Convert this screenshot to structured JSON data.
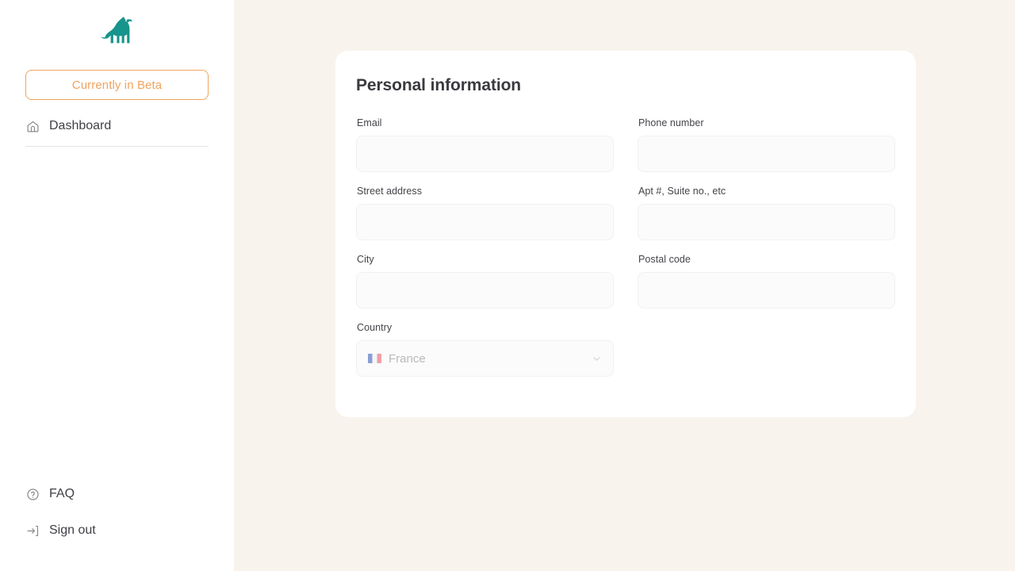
{
  "sidebar": {
    "logo": {
      "icon": "dog-logo-icon",
      "color": "#17948c"
    },
    "beta_badge": {
      "label": "Currently in Beta",
      "color": "#f0a45e"
    },
    "nav_items": [
      {
        "label": "Dashboard",
        "icon": "home-icon"
      }
    ],
    "bottom_items": [
      {
        "label": "FAQ",
        "icon": "question-circle-icon"
      },
      {
        "label": "Sign out",
        "icon": "sign-out-icon"
      }
    ]
  },
  "main": {
    "card": {
      "title": "Personal information",
      "fields": [
        {
          "key": "email",
          "label": "Email",
          "value": "",
          "placeholder": "",
          "type": "text"
        },
        {
          "key": "phone",
          "label": "Phone number",
          "value": "",
          "placeholder": "",
          "type": "text"
        },
        {
          "key": "street",
          "label": "Street address",
          "value": "",
          "placeholder": "",
          "type": "text"
        },
        {
          "key": "apt",
          "label": "Apt #, Suite no., etc",
          "value": "",
          "placeholder": "",
          "type": "text"
        },
        {
          "key": "city",
          "label": "City",
          "value": "",
          "placeholder": "",
          "type": "text"
        },
        {
          "key": "postal",
          "label": "Postal code",
          "value": "",
          "placeholder": "",
          "type": "text"
        },
        {
          "key": "country",
          "label": "Country",
          "value": "France",
          "flag": "🇫🇷",
          "type": "select"
        }
      ]
    }
  },
  "colors": {
    "page_background": "#f8f3ed",
    "sidebar_background": "#ffffff",
    "card_background": "#ffffff",
    "accent_teal": "#17948c",
    "accent_orange": "#f0a45e",
    "input_background": "#fbfbfb",
    "text_primary": "#3f3f46",
    "text_muted": "#b9b9be"
  }
}
